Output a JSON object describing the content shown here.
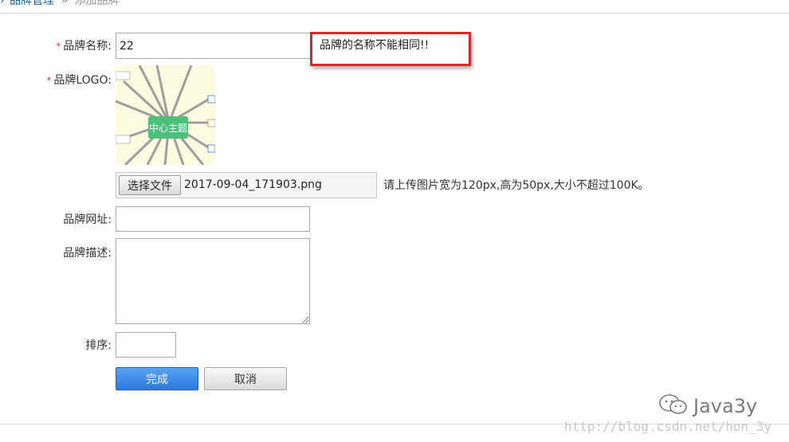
{
  "breadcrumb": {
    "parent": "品牌管理",
    "separator": "»",
    "current": "添加品牌"
  },
  "form": {
    "required_mark": "*",
    "name_label": "品牌名称:",
    "name_value": "22",
    "name_error": "品牌的名称不能相同!!",
    "logo_label": "品牌LOGO:",
    "logo_preview_text": "中心主题",
    "file_button_label": "选择文件",
    "file_name": "2017-09-04_171903.png",
    "file_hint": "请上传图片宽为120px,高为50px,大小不超过100K。",
    "url_label": "品牌网址:",
    "url_value": "",
    "desc_label": "品牌描述:",
    "desc_value": "",
    "sort_label": "排序:",
    "sort_value": ""
  },
  "actions": {
    "submit_label": "完成",
    "cancel_label": "取消"
  },
  "watermark": {
    "brand": "Java3y",
    "url": "http://blog.csdn.net/hon_3y"
  },
  "colors": {
    "required": "#e23a3a",
    "error_border": "#d42a2a",
    "primary_button": "#2a79de",
    "link": "#1a5fa6",
    "mindmap_node": "#4cc07a"
  }
}
